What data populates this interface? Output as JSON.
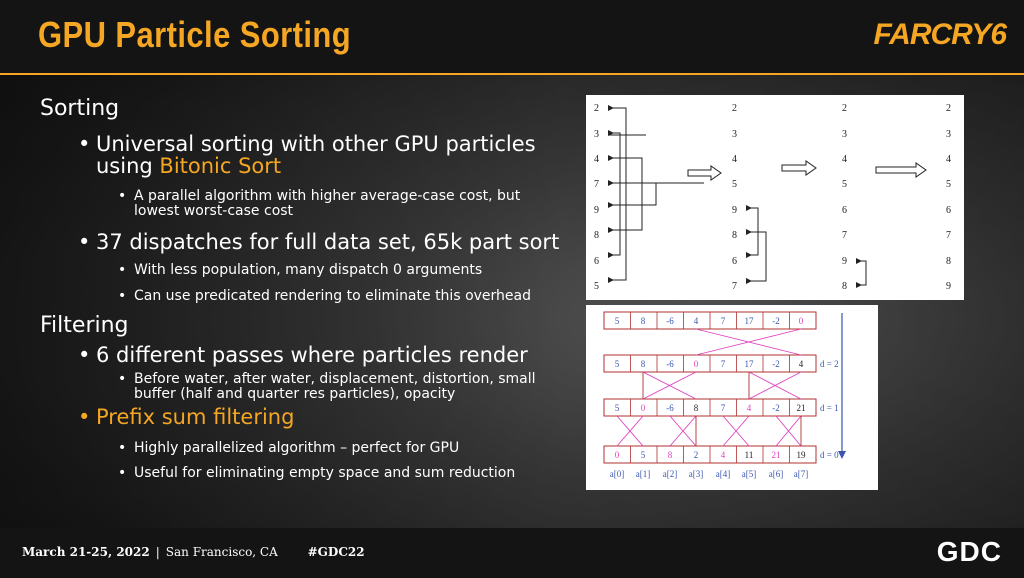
{
  "header": {
    "title": "GPU Particle Sorting",
    "logo": "FARCRY6"
  },
  "sections": [
    {
      "heading": "Sorting"
    },
    {
      "heading": "Filtering"
    }
  ],
  "bullets": {
    "b1_pre": "Universal sorting with other GPU particles using ",
    "b1_accent": "Bitonic Sort",
    "b1_sub": "A parallel algorithm with higher average-case cost, but lowest worst-case cost",
    "b2": "37 dispatches for full data set, 65k part sort",
    "b2_sub1": "With less population, many dispatch 0 arguments",
    "b2_sub2": "Can use predicated rendering to eliminate this overhead",
    "b3": "6 different passes where particles render",
    "b3_sub": "Before water, after water, displacement, distortion, small buffer (half and quarter res particles), opacity",
    "b4": "Prefix sum filtering",
    "b4_sub1": "Highly parallelized algorithm – perfect for GPU",
    "b4_sub2": "Useful for eliminating empty space and sum reduction"
  },
  "bitonic_diagram": {
    "col1": [
      "2",
      "3",
      "4",
      "7",
      "9",
      "8",
      "6",
      "5"
    ],
    "col2": [
      "2",
      "3",
      "4",
      "5",
      "9",
      "8",
      "6",
      "7"
    ],
    "col3": [
      "2",
      "3",
      "4",
      "5",
      "6",
      "7",
      "9",
      "8"
    ],
    "col4": [
      "2",
      "3",
      "4",
      "5",
      "6",
      "7",
      "8",
      "9"
    ]
  },
  "prefix_diagram": {
    "row0": [
      "5",
      "8",
      "-6",
      "4",
      "7",
      "17",
      "-2",
      "0"
    ],
    "row1": [
      "5",
      "8",
      "-6",
      "0",
      "7",
      "17",
      "-2",
      "4"
    ],
    "row2": [
      "5",
      "0",
      "-6",
      "8",
      "7",
      "4",
      "-2",
      "21"
    ],
    "row3": [
      "0",
      "5",
      "8",
      "2",
      "4",
      "11",
      "21",
      "19"
    ],
    "labels": [
      "d = 2",
      "d = 1",
      "d = 0"
    ],
    "indices": [
      "a[0]",
      "a[1]",
      "a[2]",
      "a[3]",
      "a[4]",
      "a[5]",
      "a[6]",
      "a[7]"
    ]
  },
  "footer": {
    "dates": "March 21-25, 2022",
    "location": "San Francisco, CA",
    "tag": "#GDC22",
    "brand": "GDC"
  },
  "colors": {
    "accent": "#f5a623",
    "diagram_red": "#b03030",
    "diagram_blue": "#3a55b0",
    "diagram_pink": "#e040c0"
  }
}
